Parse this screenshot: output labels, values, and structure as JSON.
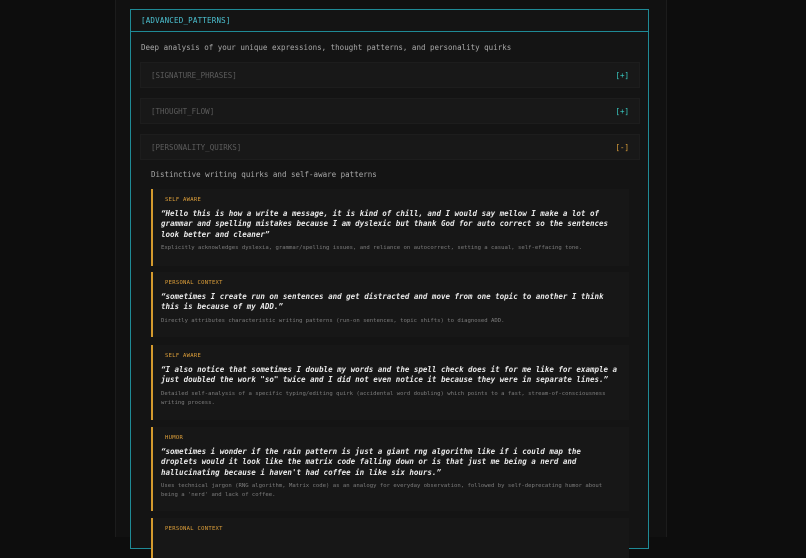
{
  "panel": {
    "title": "[ADVANCED_PATTERNS]",
    "description": "Deep analysis of your unique expressions, thought patterns, and personality quirks"
  },
  "sections": [
    {
      "label": "[SIGNATURE_PHRASES]",
      "toggle": "[+]"
    },
    {
      "label": "[THOUGHT_FLOW]",
      "toggle": "[+]"
    },
    {
      "label": "[PERSONALITY_QUIRKS]",
      "toggle": "[-]"
    }
  ],
  "quirks_section": {
    "description": "Distinctive writing quirks and self-aware patterns",
    "items": [
      {
        "tag": "SELF AWARE",
        "quote": "“Hello this is how a write a message, it is kind of chill, and I would say mellow I make a lot of grammar and spelling mistakes because I am dyslexic but thank God for auto correct so the sentences look better and cleaner”",
        "note": "Explicitly acknowledges dyslexia, grammar/spelling issues, and reliance on autocorrect, setting a casual, self-effacing tone."
      },
      {
        "tag": "PERSONAL CONTEXT",
        "quote": "“sometimes I create run on sentences and get distracted and move from one topic to another I think this is because of my ADD.”",
        "note": "Directly attributes characteristic writing patterns (run-on sentences, topic shifts) to diagnosed ADD."
      },
      {
        "tag": "SELF AWARE",
        "quote": "“I also notice that sometimes I double my words and the spell check does it for me like for example a just doubled the work \"so\" twice and I did not even notice it because they were in separate lines.”",
        "note": "Detailed self-analysis of a specific typing/editing quirk (accidental word doubling) which points to a fast, stream-of-consciousness writing process."
      },
      {
        "tag": "HUMOR",
        "quote": "“sometimes i wonder if the rain pattern is just a giant rng algorithm like if i could map the droplets would it look like the matrix code falling down or is that just me being a nerd and hallucinating because i haven't had coffee in like six hours.”",
        "note": "Uses technical jargon (RNG algorithm, Matrix code) as an analogy for everyday observation, followed by self-deprecating humor about being a 'nerd' and lack of coffee."
      },
      {
        "tag": "PERSONAL CONTEXT",
        "quote": "",
        "note": ""
      }
    ]
  }
}
